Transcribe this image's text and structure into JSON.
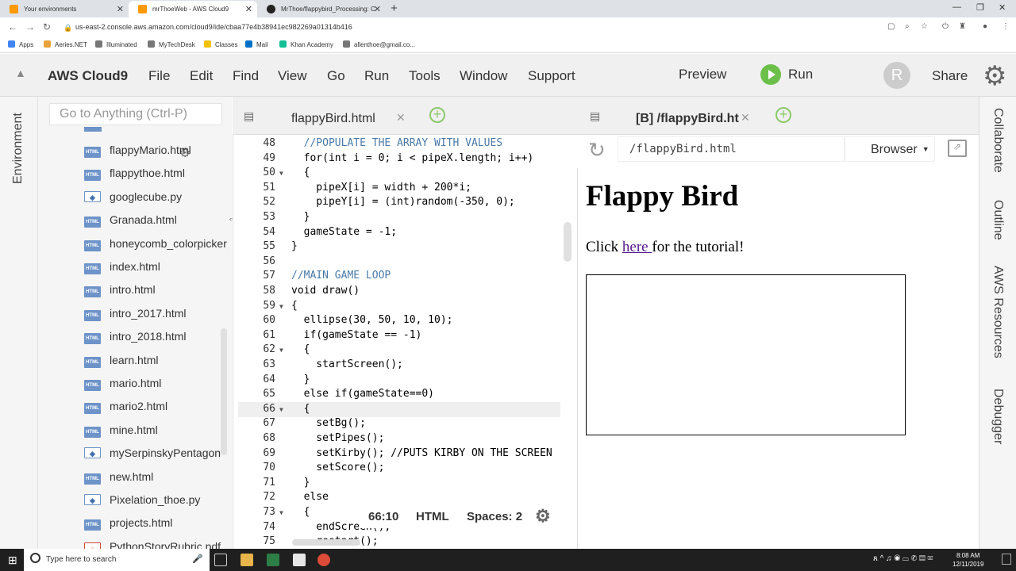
{
  "browser": {
    "tabs": [
      {
        "label": "Your environments",
        "color": "#ff9900"
      },
      {
        "label": "mrThoeWeb - AWS Cloud9",
        "color": "#ff9900"
      },
      {
        "label": "MrThoe/flappybird_Processing: C",
        "color": "#222222"
      }
    ],
    "url": "us-east-2.console.aws.amazon.com/cloud9/ide/cbaa77e4b38941ec982269a01314b416",
    "bookmarks": [
      "Apps",
      "Aeries.NET",
      "Illuminated",
      "MyTechDesk",
      "Classes",
      "Mail",
      "Khan Academy",
      "allenthoe@gmail.co..."
    ]
  },
  "menu": {
    "brand": "AWS Cloud9",
    "items": [
      "File",
      "Edit",
      "Find",
      "View",
      "Go",
      "Run",
      "Tools",
      "Window",
      "Support"
    ],
    "preview": "Preview",
    "run": "Run",
    "avatar": "R",
    "share": "Share"
  },
  "side": {
    "left_label": "Environment",
    "goto_placeholder": "Go to Anything (Ctrl-P)",
    "files": [
      {
        "name": "flappyMario.html",
        "type": "html"
      },
      {
        "name": "flappythoe.html",
        "type": "html"
      },
      {
        "name": "googlecube.py",
        "type": "py"
      },
      {
        "name": "Granada.html",
        "type": "html"
      },
      {
        "name": "honeycomb_colorpicker",
        "type": "html"
      },
      {
        "name": "index.html",
        "type": "html"
      },
      {
        "name": "intro.html",
        "type": "html"
      },
      {
        "name": "intro_2017.html",
        "type": "html"
      },
      {
        "name": "intro_2018.html",
        "type": "html"
      },
      {
        "name": "learn.html",
        "type": "html"
      },
      {
        "name": "mario.html",
        "type": "html"
      },
      {
        "name": "mario2.html",
        "type": "html"
      },
      {
        "name": "mine.html",
        "type": "html"
      },
      {
        "name": "mySerpinskyPentagon",
        "type": "py"
      },
      {
        "name": "new.html",
        "type": "html"
      },
      {
        "name": "Pixelation_thoe.py",
        "type": "py"
      },
      {
        "name": "projects.html",
        "type": "html"
      },
      {
        "name": "PythonStoryRubric.pdf",
        "type": "pdf"
      }
    ],
    "right_labels": [
      "Collaborate",
      "Outline",
      "AWS Resources",
      "Debugger"
    ]
  },
  "editor": {
    "tab": "flappyBird.html",
    "lines": [
      {
        "n": "48",
        "t": "  //POPULATE THE ARRAY WITH VALUES",
        "c": "cm"
      },
      {
        "n": "49",
        "t": "  for(int i = 0; i < pipeX.length; i++)",
        "c": ""
      },
      {
        "n": "50",
        "t": "  {",
        "c": ""
      },
      {
        "n": "51",
        "t": "    pipeX[i] = width + 200*i;",
        "c": ""
      },
      {
        "n": "52",
        "t": "    pipeY[i] = (int)random(-350, 0);",
        "c": ""
      },
      {
        "n": "53",
        "t": "  }",
        "c": ""
      },
      {
        "n": "54",
        "t": "  gameState = -1;",
        "c": ""
      },
      {
        "n": "55",
        "t": "}",
        "c": ""
      },
      {
        "n": "56",
        "t": "",
        "c": ""
      },
      {
        "n": "57",
        "t": "//MAIN GAME LOOP",
        "c": "cm"
      },
      {
        "n": "58",
        "t": "void draw()",
        "c": ""
      },
      {
        "n": "59",
        "t": "{",
        "c": ""
      },
      {
        "n": "60",
        "t": "  ellipse(30, 50, 10, 10);",
        "c": ""
      },
      {
        "n": "61",
        "t": "  if(gameState == -1)",
        "c": ""
      },
      {
        "n": "62",
        "t": "  {",
        "c": ""
      },
      {
        "n": "63",
        "t": "    startScreen();",
        "c": ""
      },
      {
        "n": "64",
        "t": "  }",
        "c": ""
      },
      {
        "n": "65",
        "t": "  else if(gameState==0)",
        "c": ""
      },
      {
        "n": "66",
        "t": "  {",
        "c": ""
      },
      {
        "n": "67",
        "t": "    setBg();",
        "c": ""
      },
      {
        "n": "68",
        "t": "    setPipes();",
        "c": ""
      },
      {
        "n": "69",
        "t": "    setKirby(); //PUTS KIRBY ON THE SCREEN",
        "c": ""
      },
      {
        "n": "70",
        "t": "    setScore();",
        "c": ""
      },
      {
        "n": "71",
        "t": "  }",
        "c": ""
      },
      {
        "n": "72",
        "t": "  else",
        "c": ""
      },
      {
        "n": "73",
        "t": "  {",
        "c": ""
      },
      {
        "n": "74",
        "t": "    endScreen();",
        "c": ""
      },
      {
        "n": "75",
        "t": "    restart();",
        "c": ""
      }
    ],
    "status": {
      "pos": "66:10",
      "lang": "HTML",
      "spaces": "Spaces: 2"
    }
  },
  "preview": {
    "tab": "[B] /flappyBird.html",
    "url": "/flappyBird.html",
    "browser": "Browser",
    "heading": "Flappy Bird",
    "text_before": "Click ",
    "link": "here ",
    "text_after": "for the tutorial!"
  },
  "taskbar": {
    "search": "Type here to search",
    "time": "8:08 AM",
    "date": "12/11/2019"
  }
}
